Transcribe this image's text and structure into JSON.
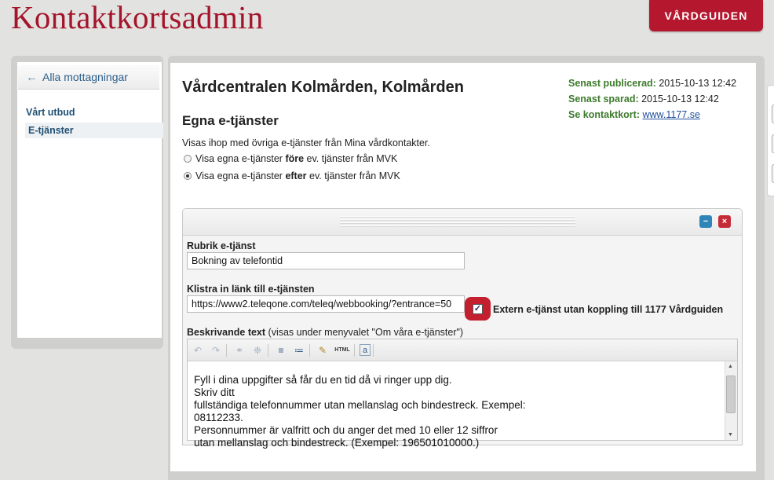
{
  "app": {
    "title": "Kontaktkortsadmin",
    "brand_button": "VÅRDGUIDEN"
  },
  "sidebar": {
    "back_label": "Alla mottagningar",
    "items": [
      {
        "label": "Vårt utbud",
        "active": false
      },
      {
        "label": "E-tjänster",
        "active": true
      }
    ]
  },
  "main": {
    "title": "Vårdcentralen Kolmården, Kolmården",
    "meta": {
      "published_label": "Senast publicerad:",
      "published_value": "2015-10-13 12:42",
      "saved_label": "Senast sparad:",
      "saved_value": "2015-10-13 12:42",
      "card_label": "Se kontaktkort:",
      "card_link": "www.1177.se"
    },
    "section_title": "Egna e-tjänster",
    "section_desc": "Visas ihop med övriga e-tjänster från Mina vårdkontakter.",
    "radio_before": {
      "pre": "Visa egna e-tjänster ",
      "bold": "före",
      "post": " ev. tjänster från MVK",
      "checked": false
    },
    "radio_after": {
      "pre": "Visa egna e-tjänster ",
      "bold": "efter",
      "post": " ev. tjänster från MVK",
      "checked": true
    }
  },
  "service": {
    "minimize_label": "−",
    "close_label": "×",
    "heading_label": "Rubrik e-tjänst",
    "heading_value": "Bokning av telefontid",
    "link_label": "Klistra in länk till e-tjänsten",
    "link_value": "https://www2.teleqone.com/teleq/webbooking/?entrance=50",
    "external_checked": true,
    "external_label": "Extern e-tjänst utan koppling till 1177 Vårdguiden",
    "description_label": "Beskrivande text",
    "description_hint": " (visas under menyvalet \"Om våra e-tjänster\")",
    "editor_lines": [
      "Fyll i dina uppgifter så får du en tid då vi ringer upp dig.",
      "Skriv ditt",
      "fullständiga telefonnummer utan mellanslag och bindestreck. Exempel:",
      "08112233.",
      "Personnummer är valfritt och du anger det med 10 eller 12 siffror",
      "utan mellanslag och bindestreck. (Exempel: 196501010000.)"
    ],
    "toolbar_html_label": "HTML"
  },
  "colors": {
    "brand": "#a4142b",
    "meta_label": "#3c7a2b",
    "link": "#1f4f9a",
    "nav_text": "#1f4f73"
  }
}
